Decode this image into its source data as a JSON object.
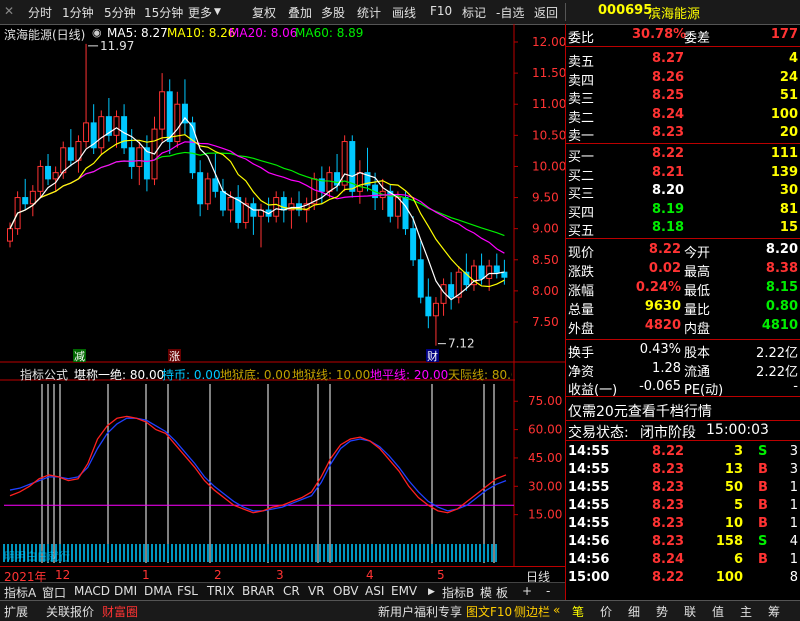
{
  "toolbar": {
    "left_items": [
      "分时",
      "1分钟",
      "5分钟",
      "15分钟",
      "更多"
    ],
    "right_items": [
      "复权",
      "叠加",
      "多股",
      "统计",
      "画线",
      "F10",
      "标记",
      "-自选",
      "返回"
    ]
  },
  "chart": {
    "title": "滨海能源(日线)",
    "ma": [
      {
        "label": "MA5: 8.27",
        "color": "#ffffff"
      },
      {
        "label": "MA10: 8.26",
        "color": "#ffff00"
      },
      {
        "label": "MA20: 8.06",
        "color": "#ff00ff"
      },
      {
        "label": "MA60: 8.89",
        "color": "#00ee00"
      }
    ],
    "price_ticks": [
      "12.00",
      "11.50",
      "11.00",
      "10.50",
      "10.00",
      "9.50",
      "9.00",
      "8.50",
      "8.00",
      "7.50"
    ],
    "high_label": "11.97",
    "low_label": "7.12",
    "signal_jian": "减",
    "signal_zhang": "涨",
    "signal_cai": "财",
    "candles": [
      [
        8.8,
        9.1,
        8.7,
        9.0
      ],
      [
        9.0,
        9.6,
        8.9,
        9.5
      ],
      [
        9.5,
        9.8,
        9.3,
        9.4
      ],
      [
        9.4,
        9.7,
        9.2,
        9.6
      ],
      [
        9.6,
        10.1,
        9.5,
        10.0
      ],
      [
        10.0,
        10.2,
        9.7,
        9.8
      ],
      [
        9.8,
        10.0,
        9.6,
        9.9
      ],
      [
        9.9,
        10.4,
        9.8,
        10.3
      ],
      [
        10.3,
        10.6,
        10.0,
        10.1
      ],
      [
        10.1,
        10.5,
        9.9,
        10.4
      ],
      [
        10.4,
        11.97,
        10.3,
        10.7
      ],
      [
        10.7,
        11.0,
        10.2,
        10.3
      ],
      [
        10.3,
        10.9,
        10.2,
        10.8
      ],
      [
        10.8,
        11.1,
        10.4,
        10.5
      ],
      [
        10.5,
        10.9,
        10.3,
        10.8
      ],
      [
        10.8,
        11.0,
        10.2,
        10.3
      ],
      [
        10.3,
        10.6,
        9.8,
        10.0
      ],
      [
        10.0,
        10.4,
        9.7,
        10.3
      ],
      [
        10.3,
        10.5,
        9.6,
        9.8
      ],
      [
        9.8,
        10.8,
        9.7,
        10.6
      ],
      [
        10.6,
        11.5,
        10.4,
        11.2
      ],
      [
        11.2,
        11.4,
        10.2,
        10.4
      ],
      [
        10.4,
        11.2,
        10.3,
        11.0
      ],
      [
        11.0,
        11.4,
        10.5,
        10.7
      ],
      [
        10.7,
        10.8,
        9.8,
        9.9
      ],
      [
        9.9,
        10.1,
        9.2,
        9.4
      ],
      [
        9.4,
        9.9,
        9.3,
        9.8
      ],
      [
        9.8,
        10.2,
        9.5,
        9.6
      ],
      [
        9.6,
        9.8,
        9.2,
        9.3
      ],
      [
        9.3,
        9.6,
        9.1,
        9.5
      ],
      [
        9.5,
        9.7,
        9.0,
        9.1
      ],
      [
        9.1,
        9.5,
        9.0,
        9.4
      ],
      [
        9.4,
        9.5,
        8.9,
        9.2
      ],
      [
        9.2,
        9.4,
        8.7,
        9.3
      ],
      [
        9.3,
        9.5,
        9.1,
        9.2
      ],
      [
        9.2,
        9.6,
        9.1,
        9.5
      ],
      [
        9.5,
        9.6,
        9.1,
        9.3
      ],
      [
        9.3,
        9.5,
        9.0,
        9.4
      ],
      [
        9.4,
        9.6,
        9.2,
        9.3
      ],
      [
        9.3,
        9.5,
        9.1,
        9.4
      ],
      [
        9.4,
        9.9,
        9.3,
        9.8
      ],
      [
        9.8,
        10.0,
        9.4,
        9.6
      ],
      [
        9.6,
        10.0,
        9.5,
        9.9
      ],
      [
        9.9,
        10.2,
        9.6,
        9.7
      ],
      [
        9.7,
        10.5,
        9.6,
        10.4
      ],
      [
        10.4,
        10.5,
        9.5,
        9.6
      ],
      [
        9.6,
        10.1,
        9.4,
        9.9
      ],
      [
        9.9,
        10.3,
        9.6,
        9.7
      ],
      [
        9.7,
        9.9,
        9.3,
        9.5
      ],
      [
        9.5,
        9.8,
        9.3,
        9.6
      ],
      [
        9.6,
        9.7,
        9.1,
        9.2
      ],
      [
        9.2,
        9.6,
        9.0,
        9.5
      ],
      [
        9.5,
        9.6,
        8.9,
        9.0
      ],
      [
        9.0,
        9.2,
        8.4,
        8.5
      ],
      [
        8.5,
        8.8,
        7.8,
        7.9
      ],
      [
        7.9,
        8.2,
        7.4,
        7.6
      ],
      [
        7.6,
        7.9,
        7.12,
        7.8
      ],
      [
        7.8,
        8.2,
        7.6,
        8.1
      ],
      [
        8.1,
        8.3,
        7.7,
        7.9
      ],
      [
        7.9,
        8.4,
        7.8,
        8.3
      ],
      [
        8.3,
        8.6,
        8.0,
        8.1
      ],
      [
        8.1,
        8.5,
        8.0,
        8.4
      ],
      [
        8.4,
        8.6,
        8.1,
        8.2
      ],
      [
        8.2,
        8.5,
        8.0,
        8.4
      ],
      [
        8.4,
        8.6,
        8.2,
        8.3
      ],
      [
        8.3,
        8.5,
        8.1,
        8.22
      ]
    ],
    "ma5_color": "#ffffff",
    "ma10_color": "#ffff00",
    "ma20_color": "#ff00ff",
    "ma60_color": "#00ee00",
    "up_color": "#ff3333",
    "down_color": "#00c8ff"
  },
  "indicator": {
    "name": "指标公式",
    "formula": "堪称一绝: 80.00",
    "hold": "持币: 0.00",
    "bottom1": "地狱底: 0.00",
    "bottom2": "地狱线: 10.00",
    "ground": "地平线: 20.00",
    "sky": "天际线: 80.0",
    "ticks": [
      "75.00",
      "60.00",
      "45.00",
      "30.00",
      "15.00"
    ],
    "watermark": "明明白白就行",
    "red_line": [
      25,
      27,
      30,
      34,
      36,
      35,
      33,
      34,
      42,
      55,
      62,
      66,
      67,
      66,
      64,
      60,
      58,
      52,
      46,
      40,
      33,
      28,
      24,
      20,
      18,
      16,
      17,
      19,
      20,
      22,
      24,
      27,
      35,
      45,
      52,
      55,
      56,
      54,
      50,
      44,
      38,
      30,
      24,
      20,
      17,
      16,
      18,
      22,
      26,
      30,
      34,
      36
    ],
    "blue_line": [
      28,
      29,
      31,
      33,
      35,
      35,
      34,
      35,
      40,
      50,
      58,
      63,
      66,
      66,
      65,
      62,
      59,
      54,
      48,
      42,
      35,
      30,
      26,
      22,
      19,
      17,
      17,
      18,
      19,
      21,
      23,
      25,
      32,
      42,
      50,
      54,
      55,
      54,
      51,
      46,
      40,
      33,
      27,
      22,
      19,
      17,
      18,
      20,
      24,
      28,
      31,
      33
    ],
    "red_color": "#ff2020",
    "blue_color": "#2040ff",
    "magenta_color": "#ff00ff"
  },
  "axis": {
    "year": "2021年",
    "months": [
      "12",
      "1",
      "2",
      "3",
      "4",
      "5"
    ],
    "period": "日线"
  },
  "bottom_tabs": [
    "指标A",
    "窗口",
    "MACD",
    "DMI",
    "DMA",
    "FSL",
    "TRIX",
    "BRAR",
    "CR",
    "VR",
    "OBV",
    "ASI",
    "EMV"
  ],
  "bottom_right_tabs": [
    "指标B",
    "模",
    "板",
    "+",
    "-"
  ],
  "status_tabs": [
    "扩展",
    "关联报价",
    "财富圈"
  ],
  "status_promo": "新用户福利专享",
  "status_f10": "图文F10",
  "status_side": "侧边栏",
  "status_right_tabs": [
    "笔",
    "价",
    "细",
    "势",
    "联",
    "值",
    "主",
    "筹"
  ],
  "quote": {
    "code": "000695",
    "name": "滨海能源",
    "weibi_label": "委比",
    "weibi": "30.78%",
    "weicha_label": "委差",
    "weicha": "177",
    "sell": [
      {
        "label": "卖五",
        "price": "8.27",
        "vol": "4"
      },
      {
        "label": "卖四",
        "price": "8.26",
        "vol": "24"
      },
      {
        "label": "卖三",
        "price": "8.25",
        "vol": "51"
      },
      {
        "label": "卖二",
        "price": "8.24",
        "vol": "100"
      },
      {
        "label": "卖一",
        "price": "8.23",
        "vol": "20"
      }
    ],
    "buy": [
      {
        "label": "买一",
        "price": "8.22",
        "vol": "111",
        "pc": "red"
      },
      {
        "label": "买二",
        "price": "8.21",
        "vol": "139",
        "pc": "red"
      },
      {
        "label": "买三",
        "price": "8.20",
        "vol": "30",
        "pc": "white"
      },
      {
        "label": "买四",
        "price": "8.19",
        "vol": "81",
        "pc": "green"
      },
      {
        "label": "买五",
        "price": "8.18",
        "vol": "15",
        "pc": "green"
      }
    ],
    "stats": [
      {
        "l1": "现价",
        "v1": "8.22",
        "c1": "red",
        "l2": "今开",
        "v2": "8.20",
        "c2": "white"
      },
      {
        "l1": "涨跌",
        "v1": "0.02",
        "c1": "red",
        "l2": "最高",
        "v2": "8.38",
        "c2": "red"
      },
      {
        "l1": "涨幅",
        "v1": "0.24%",
        "c1": "red",
        "l2": "最低",
        "v2": "8.15",
        "c2": "green"
      },
      {
        "l1": "总量",
        "v1": "9630",
        "c1": "yellow",
        "l2": "量比",
        "v2": "0.80",
        "c2": "green"
      },
      {
        "l1": "外盘",
        "v1": "4820",
        "c1": "red",
        "l2": "内盘",
        "v2": "4810",
        "c2": "green"
      }
    ],
    "stats2": [
      {
        "l1": "换手",
        "v1": "0.43%",
        "l2": "股本",
        "v2": "2.22亿"
      },
      {
        "l1": "净资",
        "v1": "1.28",
        "l2": "流通",
        "v2": "2.22亿"
      },
      {
        "l1": "收益(一)",
        "v1": "-0.065",
        "l2": "PE(动)",
        "v2": "-"
      }
    ],
    "promo": "仅需20元查看千档行情",
    "trade_status_label": "交易状态:",
    "trade_status": "闭市阶段",
    "trade_time": "15:00:03",
    "ticks": [
      {
        "t": "14:55",
        "p": "8.22",
        "pc": "red",
        "v": "3",
        "s": "S",
        "sc": "green",
        "n": "3"
      },
      {
        "t": "14:55",
        "p": "8.23",
        "pc": "red",
        "v": "13",
        "s": "B",
        "sc": "red",
        "n": "3"
      },
      {
        "t": "14:55",
        "p": "8.23",
        "pc": "red",
        "v": "50",
        "s": "B",
        "sc": "red",
        "n": "1"
      },
      {
        "t": "14:55",
        "p": "8.23",
        "pc": "red",
        "v": "5",
        "s": "B",
        "sc": "red",
        "n": "1"
      },
      {
        "t": "14:55",
        "p": "8.23",
        "pc": "red",
        "v": "10",
        "s": "B",
        "sc": "red",
        "n": "1"
      },
      {
        "t": "14:56",
        "p": "8.23",
        "pc": "red",
        "v": "158",
        "s": "S",
        "sc": "green",
        "n": "4"
      },
      {
        "t": "14:56",
        "p": "8.24",
        "pc": "red",
        "v": "6",
        "s": "B",
        "sc": "red",
        "n": "1"
      },
      {
        "t": "15:00",
        "p": "8.22",
        "pc": "red",
        "v": "100",
        "s": "",
        "sc": "red",
        "n": "8"
      }
    ]
  }
}
